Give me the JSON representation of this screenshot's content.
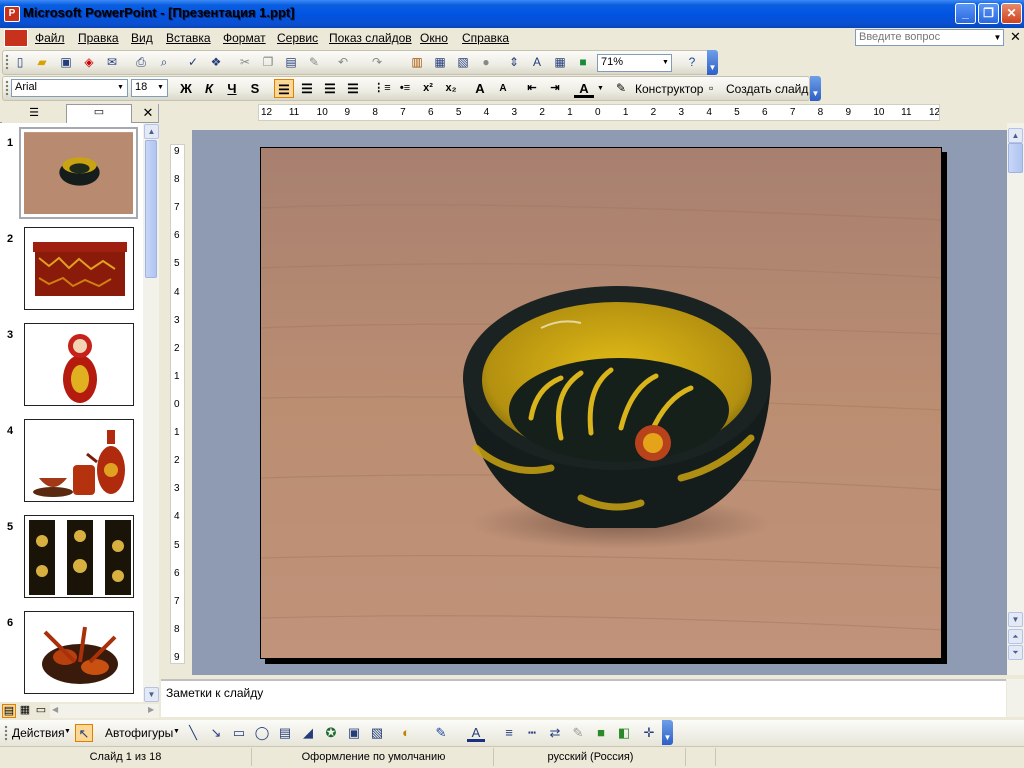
{
  "window": {
    "title": "Microsoft PowerPoint - [Презентация 1.ppt]",
    "app_icon": "powerpoint-icon"
  },
  "menu": {
    "items": [
      "Файл",
      "Правка",
      "Вид",
      "Вставка",
      "Формат",
      "Сервис",
      "Показ слайдов",
      "Окно",
      "Справка"
    ],
    "help_placeholder": "Введите вопрос"
  },
  "standard_toolbar": {
    "zoom": "71%"
  },
  "formatting_toolbar": {
    "font": "Arial",
    "size": "18",
    "bold": "Ж",
    "italic": "К",
    "underline": "Ч",
    "shadow": "S",
    "designer": "Конструктор",
    "new_slide": "Создать слайд"
  },
  "slides_pane": {
    "numbers": [
      "1",
      "2",
      "3",
      "4",
      "5",
      "6"
    ]
  },
  "hruler": {
    "labels": [
      "12",
      "11",
      "10",
      "9",
      "8",
      "7",
      "6",
      "5",
      "4",
      "3",
      "2",
      "1",
      "0",
      "1",
      "2",
      "3",
      "4",
      "5",
      "6",
      "7",
      "8",
      "9",
      "10",
      "11",
      "12"
    ]
  },
  "vruler": {
    "labels": [
      "9",
      "8",
      "7",
      "6",
      "5",
      "4",
      "3",
      "2",
      "1",
      "0",
      "1",
      "2",
      "3",
      "4",
      "5",
      "6",
      "7",
      "8",
      "9"
    ]
  },
  "notes": {
    "placeholder": "Заметки к слайду"
  },
  "drawing_toolbar": {
    "actions": "Действия",
    "autoshapes": "Автофигуры"
  },
  "status": {
    "slide": "Слайд 1 из 18",
    "design": "Оформление по умолчанию",
    "language": "русский (Россия)"
  },
  "colors": {
    "titlebar": "#0054e3",
    "slide_area": "#8f9bb3",
    "wood": "#b88a6f",
    "bowl_black": "#141d1c",
    "bowl_gold": "#c9a312"
  }
}
